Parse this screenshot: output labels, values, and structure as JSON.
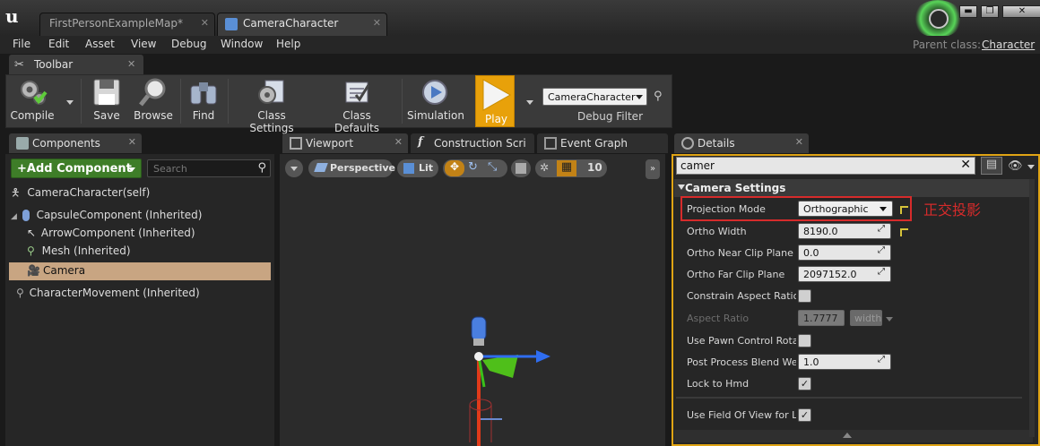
{
  "tabs": {
    "map": "FirstPersonExampleMap*",
    "bp": "CameraCharacter"
  },
  "window_buttons": [
    "▬",
    "❐",
    "✕"
  ],
  "menu": [
    "File",
    "Edit",
    "Asset",
    "View",
    "Debug",
    "Window",
    "Help"
  ],
  "parent_class": {
    "label": "Parent class:",
    "value": "Character"
  },
  "toolbar": {
    "tab": "Toolbar",
    "buttons": [
      "Compile",
      "Save",
      "Browse",
      "Find",
      "Class Settings",
      "Class Defaults",
      "Simulation",
      "Play"
    ],
    "debug_select": "CameraCharacter",
    "debug_filter": "Debug Filter"
  },
  "components": {
    "tab": "Components",
    "add_button": "+Add Component",
    "search_placeholder": "Search",
    "items": [
      "CameraCharacter(self)",
      "CapsuleComponent (Inherited)",
      "ArrowComponent (Inherited)",
      "Mesh (Inherited)",
      "Camera",
      "CharacterMovement (Inherited)"
    ]
  },
  "viewport": {
    "tabs": [
      "Viewport",
      "Construction Scri",
      "Event Graph"
    ],
    "perspective": "Perspective",
    "lit": "Lit",
    "snap_value": "10"
  },
  "details": {
    "tab": "Details",
    "search_value": "camer",
    "section": "Camera Settings",
    "annotation": "正交投影",
    "rows": [
      {
        "label": "Projection Mode",
        "value": "Orthographic"
      },
      {
        "label": "Ortho Width",
        "value": "8190.0"
      },
      {
        "label": "Ortho Near Clip Plane",
        "value": "0.0"
      },
      {
        "label": "Ortho Far Clip Plane",
        "value": "2097152.0"
      },
      {
        "label": "Constrain Aspect Ratio",
        "checked": false
      },
      {
        "label": "Aspect Ratio",
        "value": "1.7777",
        "unit": "width"
      },
      {
        "label": "Use Pawn Control Rotati",
        "checked": false
      },
      {
        "label": "Post Process Blend Wei",
        "value": "1.0"
      },
      {
        "label": "Lock to Hmd",
        "checked": true
      },
      {
        "label": "Use Field Of View for LC",
        "checked": true
      }
    ]
  },
  "colors": {
    "accent": "#e8a10a",
    "highlight_red": "#d62b2b",
    "selected_row": "#c8a582",
    "add_green": "#3e7d28"
  }
}
